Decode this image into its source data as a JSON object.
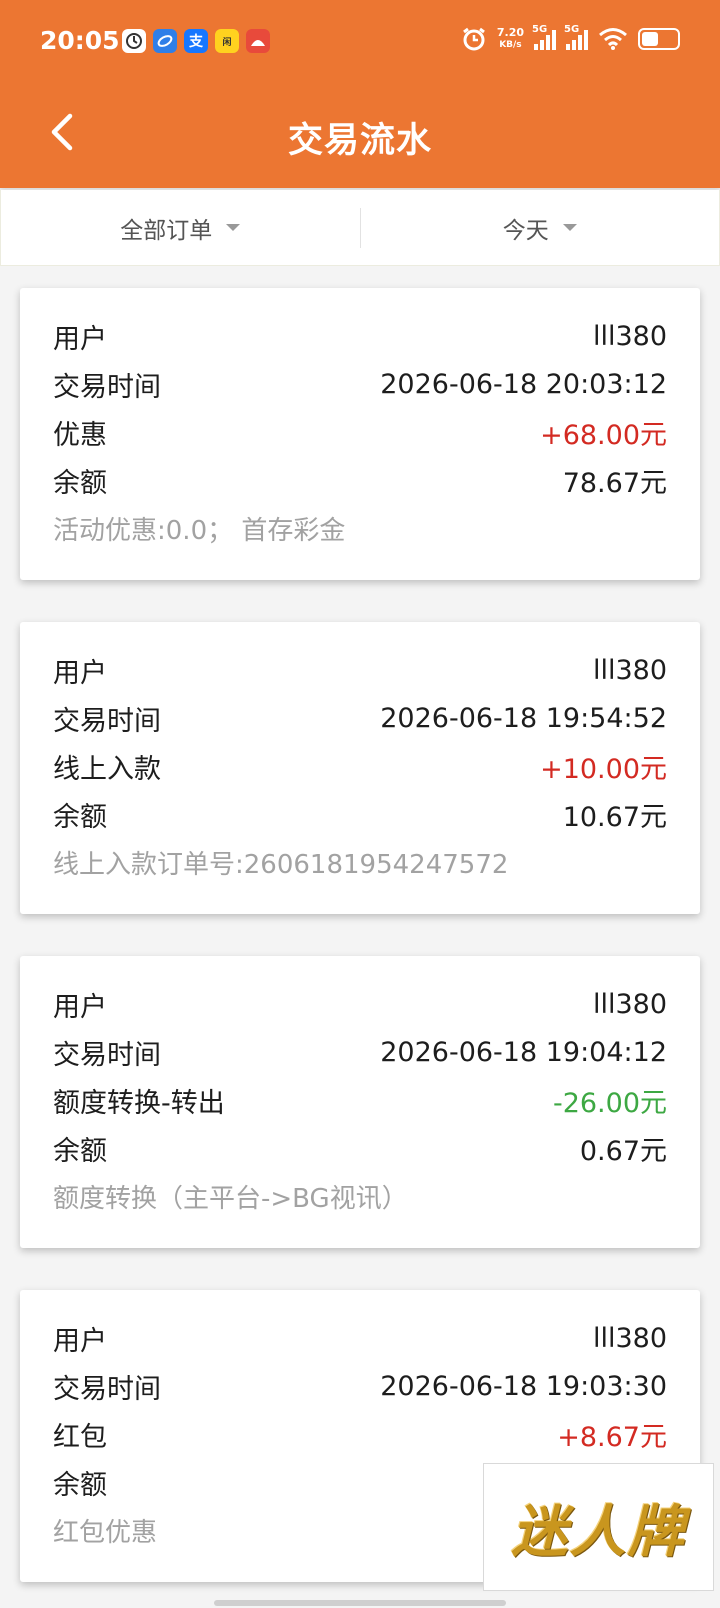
{
  "status_bar": {
    "time": "20:05",
    "net_speed_value": "7.20",
    "net_speed_unit": "KB/s",
    "signal1_label": "5G",
    "signal2_label": "5G",
    "battery_icon": "battery-icon",
    "app_icons": [
      "clock-app-icon",
      "browser-app-icon",
      "alipay-app-icon",
      "game-app-icon",
      "red-app-icon"
    ]
  },
  "header": {
    "title": "交易流水",
    "back_icon": "chevron-left-icon",
    "color": "#ec7632"
  },
  "filters": {
    "order_filter": "全部订单",
    "date_filter": "今天"
  },
  "colors": {
    "positive": "#d32a22",
    "negative": "#3da843",
    "note": "#a2a2a2"
  },
  "transactions": [
    {
      "user_label": "用户",
      "user": "lll380",
      "time_label": "交易时间",
      "time": "2026-06-18 20:03:12",
      "type_label": "优惠",
      "amount": "+68.00元",
      "balance_label": "余额",
      "balance": "78.67元",
      "note": "活动优惠:0.0；  首存彩金"
    },
    {
      "user_label": "用户",
      "user": "lll380",
      "time_label": "交易时间",
      "time": "2026-06-18 19:54:52",
      "type_label": "线上入款",
      "amount": "+10.00元",
      "balance_label": "余额",
      "balance": "10.67元",
      "note": "线上入款订单号:2606181954247572"
    },
    {
      "user_label": "用户",
      "user": "lll380",
      "time_label": "交易时间",
      "time": "2026-06-18 19:04:12",
      "type_label": "额度转换-转出",
      "amount": "-26.00元",
      "balance_label": "余额",
      "balance": "0.67元",
      "note": "额度转换（主平台->BG视讯）"
    },
    {
      "user_label": "用户",
      "user": "lll380",
      "time_label": "交易时间",
      "time": "2026-06-18 19:03:30",
      "type_label": "红包",
      "amount": "+8.67元",
      "balance_label": "余额",
      "balance": "",
      "note": "红包优惠"
    }
  ],
  "watermark": "迷人牌"
}
